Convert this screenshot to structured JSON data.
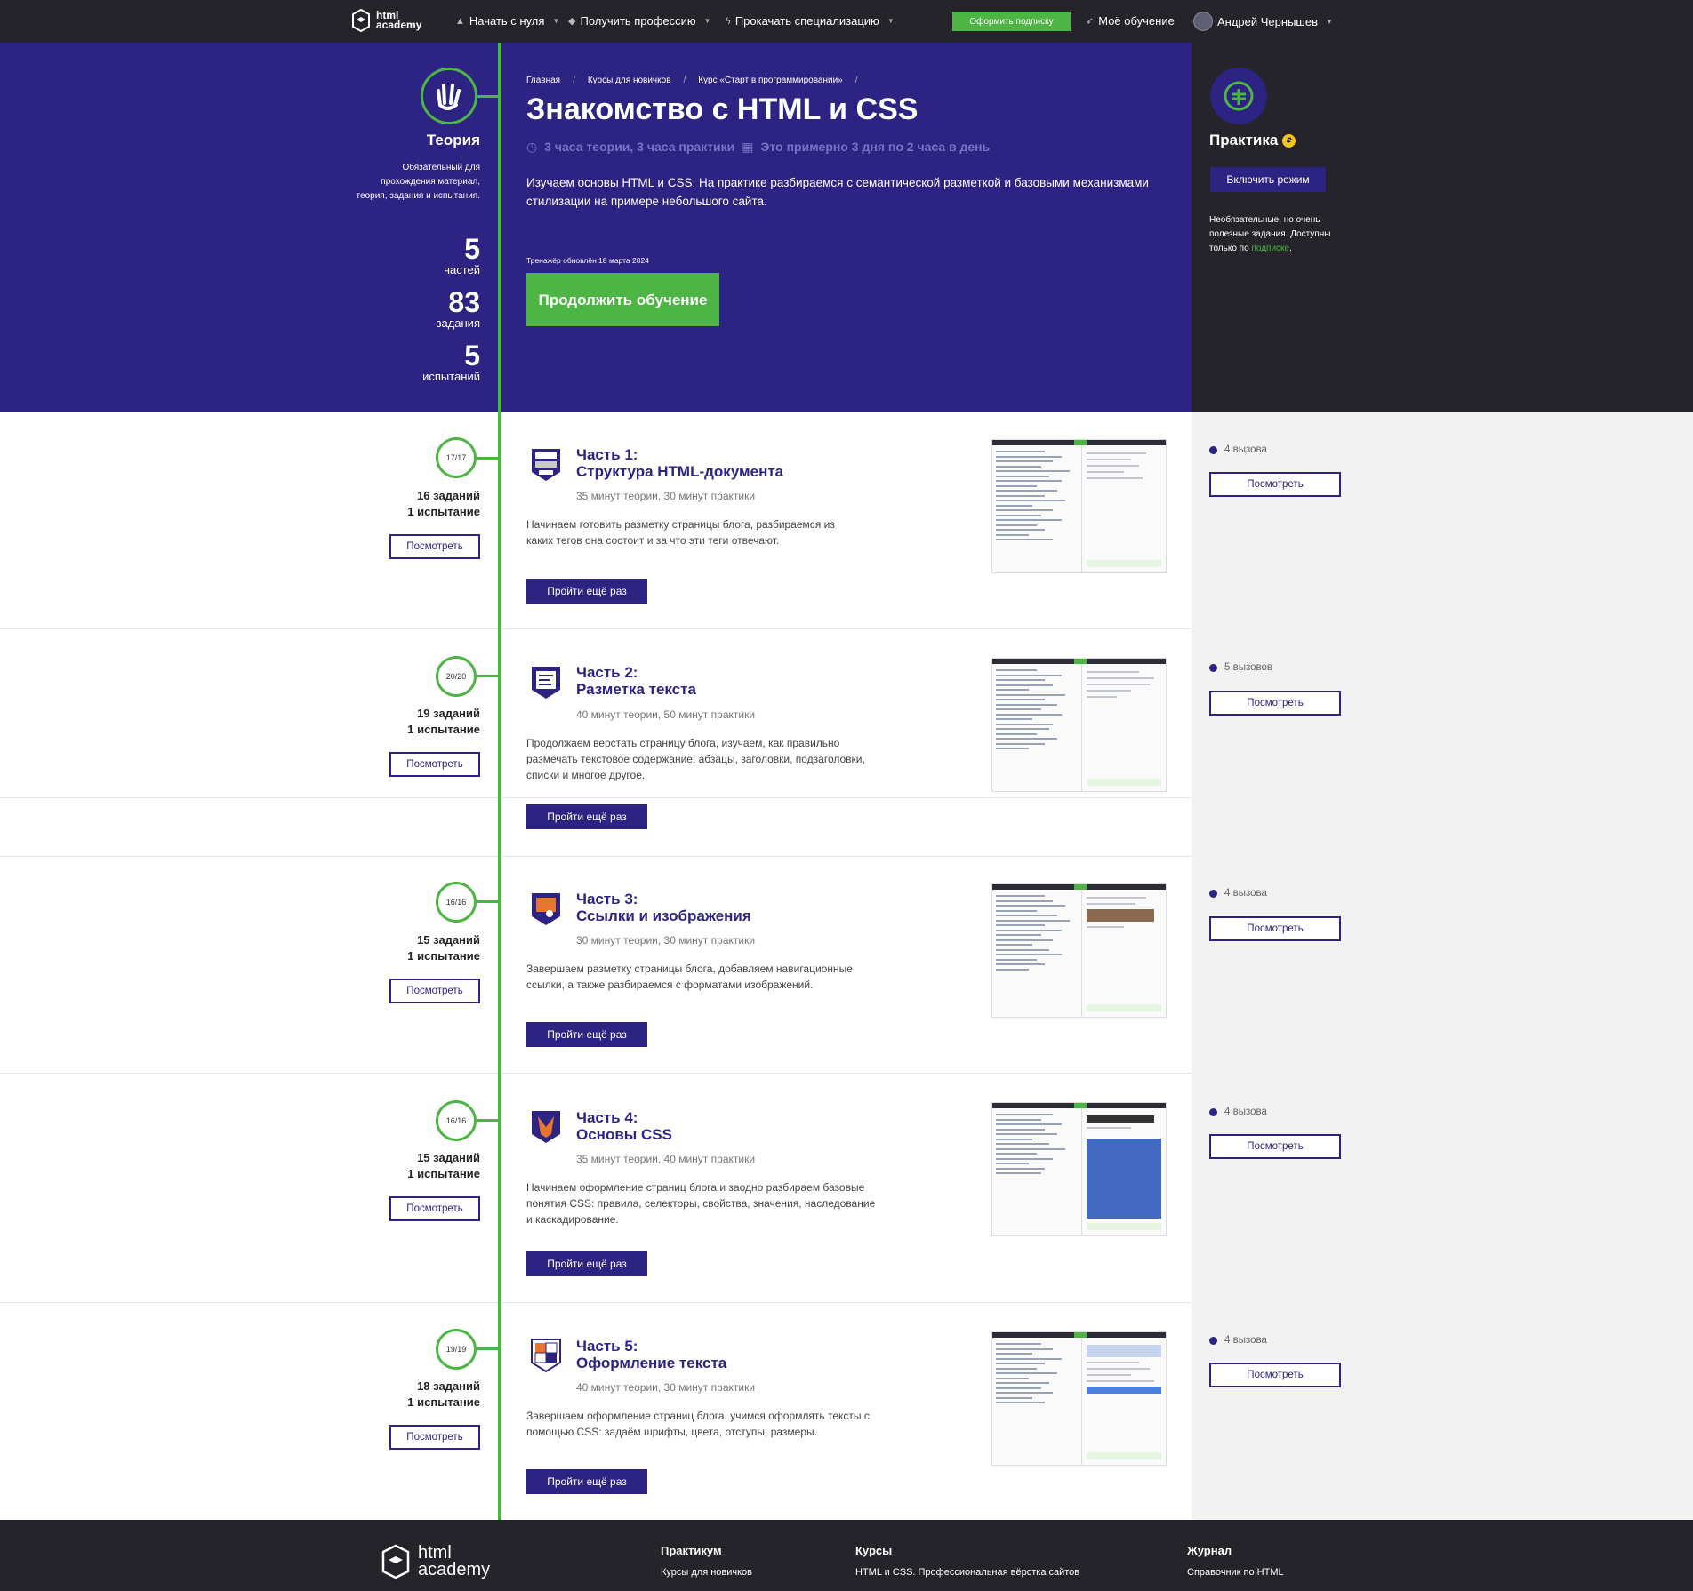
{
  "nav": {
    "logo": "html academy",
    "start": "Начать с нуля",
    "profession": "Получить профессию",
    "specialization": "Прокачать специализацию",
    "subscribe": "Оформить подписку",
    "my_learning": "Моё обучение",
    "user": "Андрей Чернышев"
  },
  "hero": {
    "breadcrumb": [
      "Главная",
      "Курсы для новичков",
      "Курс «Старт в программировании»"
    ],
    "title": "Знакомство с HTML и CSS",
    "time": "3 часа теории, 3 часа практики",
    "pace": "Это примерно 3 дня по 2 часа в день",
    "description": "Изучаем основы HTML и CSS. На практике разбираемся с семантической разметкой и базовыми механизмами стилизации на примере небольшого сайта.",
    "updated": "Тренажёр обновлён 18 марта 2024",
    "continue": "Продолжить обучение"
  },
  "theory": {
    "title": "Теория",
    "description": "Обязательный для прохождения материал, теория, задания и испытания.",
    "stats": [
      {
        "num": "5",
        "label": "частей"
      },
      {
        "num": "83",
        "label": "задания"
      },
      {
        "num": "5",
        "label": "испытаний"
      }
    ]
  },
  "practice": {
    "title": "Практика",
    "coin": "₽",
    "enable": "Включить режим",
    "note_1": "Необязательные, но очень полезные задания. Доступны только по",
    "note_link": "подписке",
    "note_end": "."
  },
  "parts": [
    {
      "progress": "17/17",
      "tasks": "16 заданий",
      "tests": "1 испытание",
      "number": "Часть 1:",
      "name": "Структура HTML-документа",
      "time": "35 минут теории, 30 минут практики",
      "desc": "Начинаем готовить разметку страницы блога, разбираемся из каких тегов она состоит и за что эти теги отвечают.",
      "challenges": "4 вызова"
    },
    {
      "progress": "20/20",
      "tasks": "19 заданий",
      "tests": "1 испытание",
      "number": "Часть 2:",
      "name": "Разметка текста",
      "time": "40 минут теории, 50 минут практики",
      "desc": "Продолжаем верстать страницу блога, изучаем, как правильно размечать текстовое содержание: абзацы, заголовки, подзаголовки, списки и многое другое.",
      "challenges": "5 вызовов"
    },
    {
      "progress": "16/16",
      "tasks": "15 заданий",
      "tests": "1 испытание",
      "number": "Часть 3:",
      "name": "Ссылки и изображения",
      "time": "30 минут теории, 30 минут практики",
      "desc": "Завершаем разметку страницы блога, добавляем навигационные ссылки, а также разбираемся с форматами изображений.",
      "challenges": "4 вызова"
    },
    {
      "progress": "16/16",
      "tasks": "15 заданий",
      "tests": "1 испытание",
      "number": "Часть 4:",
      "name": "Основы CSS",
      "time": "35 минут теории, 40 минут практики",
      "desc": "Начинаем оформление страниц блога и заодно разбираем базовые понятия CSS: правила, селекторы, свойства, значения, наследование и каскадирование.",
      "challenges": "4 вызова"
    },
    {
      "progress": "19/19",
      "tasks": "18 заданий",
      "tests": "1 испытание",
      "number": "Часть 5:",
      "name": "Оформление текста",
      "time": "40 минут теории, 30 минут практики",
      "desc": "Завершаем оформление страниц блога, учимся оформлять тексты с помощью CSS: задаём шрифты, цвета, отступы, размеры.",
      "challenges": "4 вызова"
    }
  ],
  "buttons": {
    "view": "Посмотреть",
    "retry": "Пройти ещё раз"
  },
  "footer": {
    "logo": "html academy",
    "col1_title": "Практикум",
    "col1_link": "Курсы для новичков",
    "col2_title": "Курсы",
    "col2_link": "HTML и CSS. Профессиональная вёрстка сайтов",
    "col3_title": "Журнал",
    "col3_link": "Справочник по HTML"
  },
  "colors": {
    "brand": "#2c2382",
    "accent": "#4cb543",
    "dark": "#25242a"
  },
  "icons": {
    "start": "signpost-icon",
    "profession": "graduation-cap-icon",
    "specialization": "lightning-icon",
    "my_learning": "rocket-icon",
    "theory": "vulcan-hand-icon",
    "practice": "fist-icon",
    "time": "clock-icon",
    "pace": "calendar-icon"
  }
}
